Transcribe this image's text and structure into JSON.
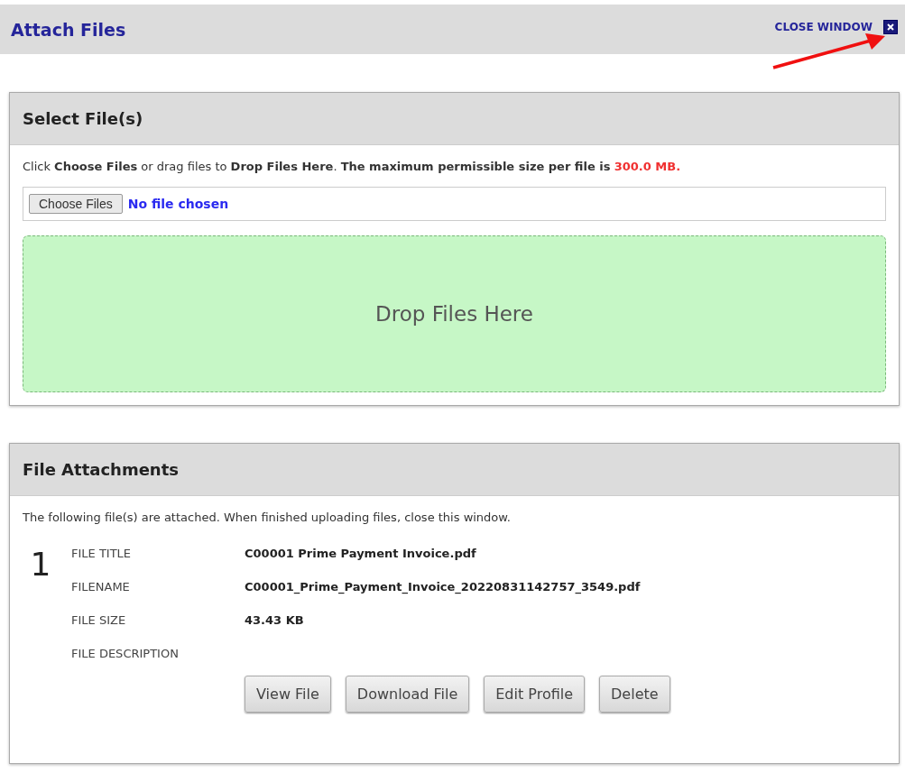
{
  "header": {
    "title": "Attach Files",
    "close_label": "CLOSE WINDOW",
    "annotation_arrow": true
  },
  "select_panel": {
    "title": "Select File(s)",
    "instruction": "Click **Choose Files** or drag files to **Drop Files Here**. **The maximum permissible size per file is**",
    "size_limit": "300.0 MB.",
    "choose_button": "Choose Files",
    "file_status": "No file chosen",
    "drop_zone": "Drop Files Here"
  },
  "attachments_panel": {
    "title": "File Attachments",
    "note": "The following file(s) are attached. When finished uploading files, close this window.",
    "files": [
      {
        "number": "1",
        "fields": [
          {
            "label": "FILE TITLE",
            "value": "C00001 Prime Payment Invoice.pdf"
          },
          {
            "label": "FILENAME",
            "value": "C00001_Prime_Payment_Invoice_20220831142757_3549.pdf"
          },
          {
            "label": "FILE SIZE",
            "value": "43.43 KB"
          },
          {
            "label": "FILE DESCRIPTION"
          }
        ],
        "buttons": [
          "View File",
          "Download File",
          "Edit Profile",
          "Delete"
        ]
      }
    ]
  }
}
